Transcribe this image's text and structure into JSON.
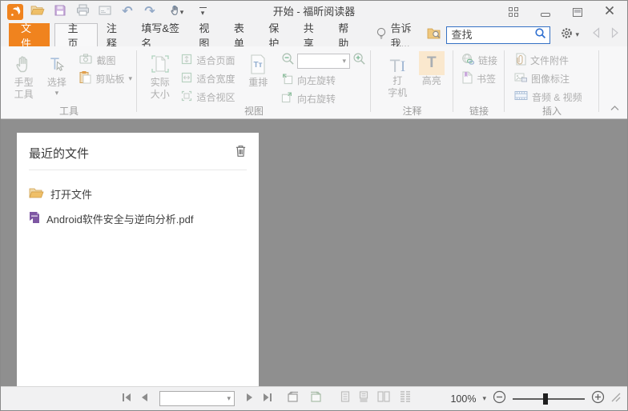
{
  "window": {
    "title": "开始 - 福昕阅读器"
  },
  "tab_bar": {
    "file_tab": "文件",
    "tabs": [
      {
        "label": "主页",
        "active": true
      },
      {
        "label": "注释"
      },
      {
        "label": "填写&签名"
      },
      {
        "label": "视图"
      },
      {
        "label": "表单"
      },
      {
        "label": "保护"
      },
      {
        "label": "共享"
      },
      {
        "label": "帮助"
      }
    ],
    "tell_me": "告诉我...",
    "search": {
      "placeholder": "查找"
    }
  },
  "ribbon": {
    "tools_group": {
      "label": "工具",
      "hand_tool": {
        "line1": "手型",
        "line2": "工具"
      },
      "select": "选择",
      "snapshot": "截图",
      "clipboard": "剪贴板"
    },
    "view_group": {
      "label": "视图",
      "actual_size": {
        "line1": "实际",
        "line2": "大小"
      },
      "fit_page": "适合页面",
      "fit_width": "适合宽度",
      "fit_visible": "适合视区",
      "reflow": "重排",
      "rotate_left": "向左旋转",
      "rotate_right": "向右旋转"
    },
    "comment_group": {
      "label": "注释",
      "typewriter": {
        "line1": "打",
        "line2": "字机"
      },
      "highlight": "高亮"
    },
    "link_group": {
      "label": "链接",
      "link": "链接",
      "bookmark": "书签"
    },
    "insert_group": {
      "label": "插入",
      "file_attachment": "文件附件",
      "image_annotation": "图像标注",
      "audio_video": "音频 & 视频"
    }
  },
  "recent_panel": {
    "title": "最近的文件",
    "open_file": "打开文件",
    "files": [
      {
        "name": "Android软件安全与逆向分析.pdf"
      }
    ]
  },
  "status_bar": {
    "zoom_level": "100%"
  },
  "glyphs": {
    "caret_down": "▾",
    "undo": "↶",
    "redo": "↷",
    "highlight_T": "T",
    "typewriter_T": "T",
    "typewriter_I": "I",
    "reflow_Tt": "Tт"
  },
  "colors": {
    "accent_orange": "#F0831E",
    "highlight_bg": "#FAE8CE",
    "search_border": "#3571C4",
    "pdf_purple": "#7E57A3",
    "folder_tan": "#EFBF67",
    "content_bg": "#8F8F8F",
    "disabled_icon": "#C2CBC5"
  }
}
